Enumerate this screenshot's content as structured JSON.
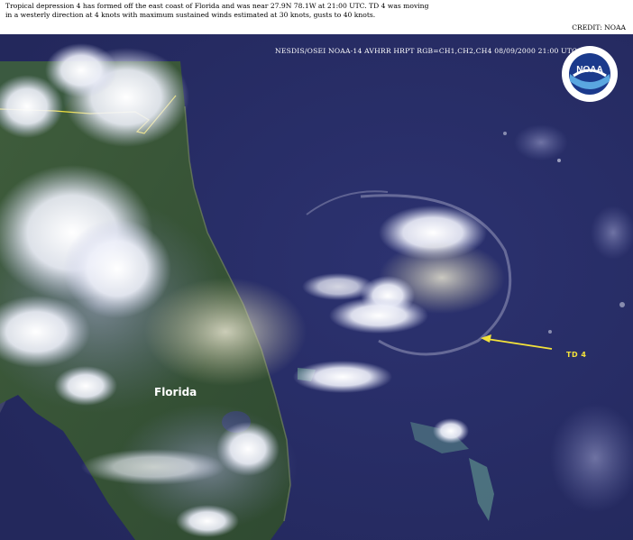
{
  "caption": {
    "line1": "Tropical depression  4 has formed off the east coast of Florida and was near 27.9N 78.1W at 21:00 UTC.  TD 4 was moving",
    "line2": "in a westerly direction at 4 knots with maximum sustained winds estimated at 30 knots, gusts to 40 knots."
  },
  "credit": "CREDIT: NOAA",
  "image_header": "NESDIS/OSEI  NOAA-14 AVHRR HRPT  RGB=CH1,CH2,CH4  08/09/2000  21:00 UTC",
  "logo_text": "NOAA",
  "labels": {
    "florida": "Florida",
    "storm": "TD 4"
  },
  "colors": {
    "ocean": "#2a2f66",
    "land": "#3d5a3a",
    "cloud": "#f4f6fb",
    "annotation": "#f3e23a"
  }
}
